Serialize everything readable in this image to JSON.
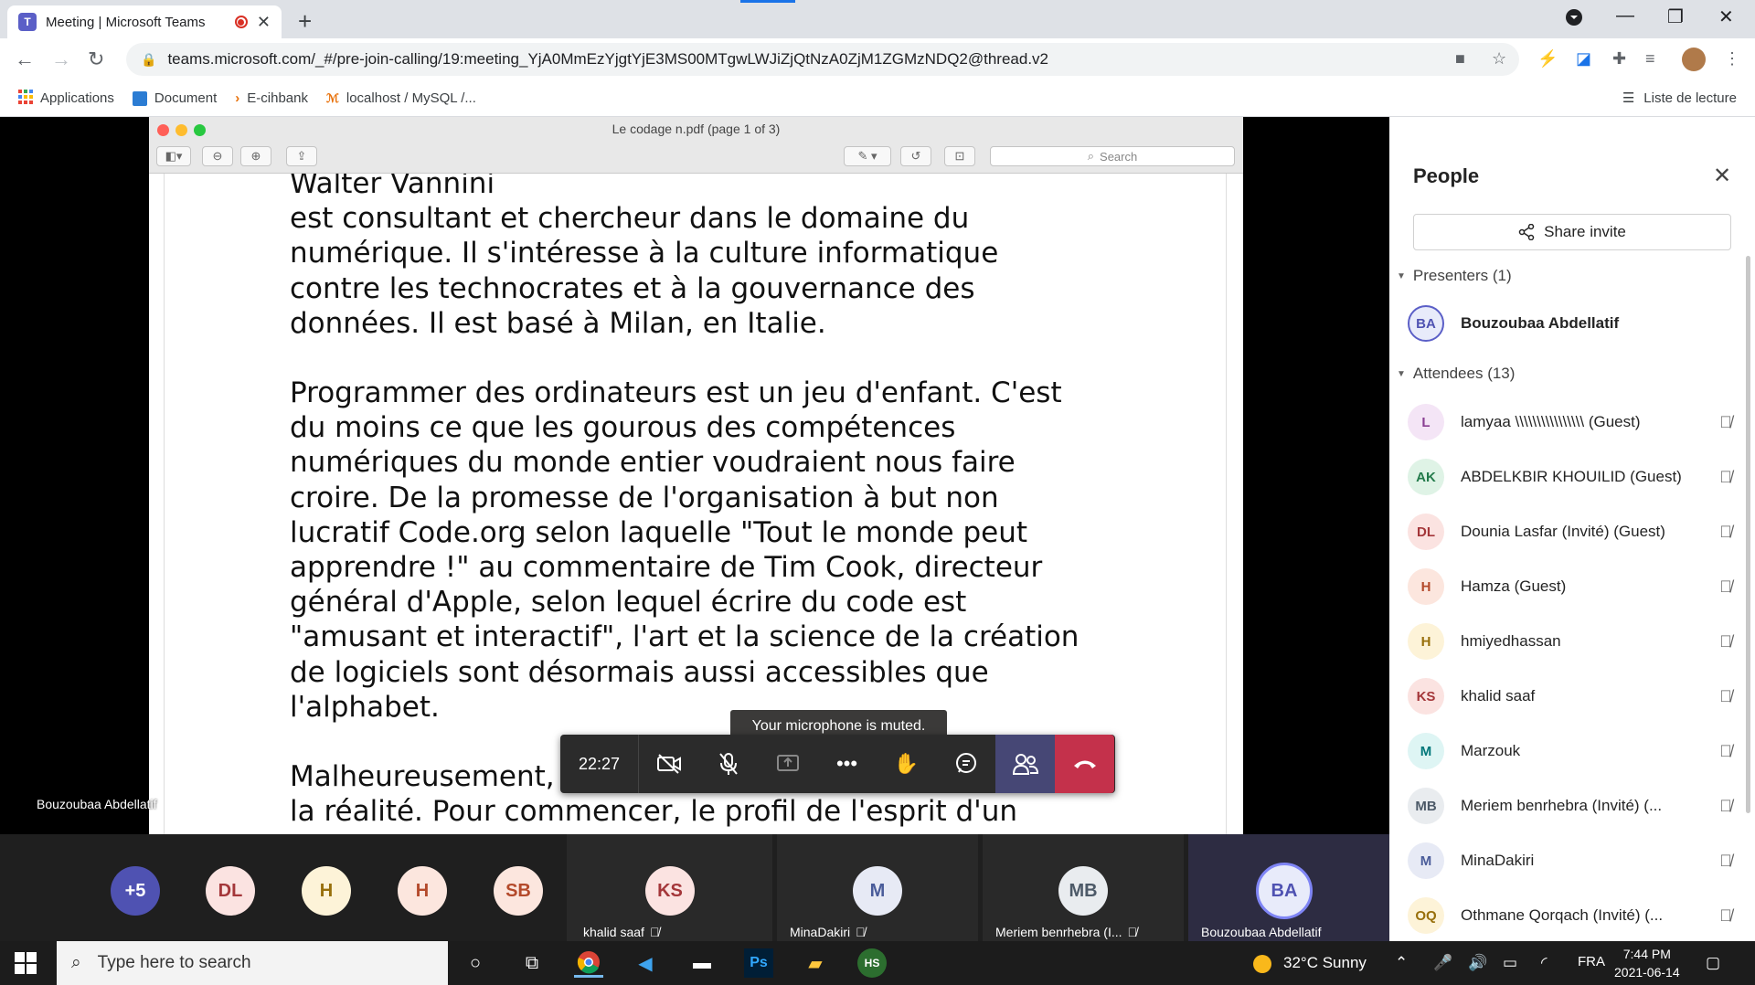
{
  "browser": {
    "tab_title": "Meeting | Microsoft Teams",
    "teams_logo": "T",
    "url": "teams.microsoft.com/_#/pre-join-calling/19:meeting_YjA0MmEzYjgtYjE3MS00MTgwLWJiZjQtNzA0ZjM1ZGMzNDQ2@thread.v2",
    "bookmarks": [
      "Applications",
      "Document",
      "E-cihbank",
      "localhost / MySQL /..."
    ],
    "reading_list": "Liste de lecture"
  },
  "pdf": {
    "title": "Le codage n.pdf (page 1 of 3)",
    "search_placeholder": "Search",
    "paragraphs": [
      "Walter Vannini\nest consultant et chercheur dans le domaine du\nnumérique. Il s'intéresse à la culture informatique\ncontre les technocrates et à la gouvernance des\ndonnées. Il est basé à Milan, en Italie.",
      "Programmer des ordinateurs est un jeu d'enfant. C'est\ndu moins ce que les gourous des compétences\nnumériques du monde entier voudraient nous faire\ncroire. De la promesse de l'organisation à but non\nlucratif Code.org selon laquelle \"Tout le monde peut\napprendre !\" au commentaire de Tim Cook, directeur\ngénéral d'Apple, selon lequel écrire du code est\n\"amusant et interactif\", l'art et la science de la création\nde logiciels sont désormais aussi accessibles que\nl'alphabet.",
      "Malheureusement, ce portrait n'a rien à voir avec\nla réalité. Pour commencer, le profil de l'esprit d'un"
    ]
  },
  "presenter_label": "Bouzoubaa Abdellatif",
  "call": {
    "duration": "22:27",
    "tooltip": "Your microphone is muted."
  },
  "people": {
    "title": "People",
    "share_invite": "Share invite",
    "presenters_header": "Presenters (1)",
    "attendees_header": "Attendees (13)",
    "presenters": [
      {
        "initials": "BA",
        "name": "Bouzoubaa Abdellatif"
      }
    ],
    "attendees": [
      {
        "initials": "L",
        "name": "lamyaa \\\\\\\\\\\\\\\\\\\\\\\\\\\\\\\\ (Guest)"
      },
      {
        "initials": "AK",
        "name": "ABDELKBIR KHOUILID (Guest)"
      },
      {
        "initials": "DL",
        "name": "Dounia Lasfar (Invité) (Guest)"
      },
      {
        "initials": "H",
        "name": "Hamza (Guest)"
      },
      {
        "initials": "H",
        "name": "hmiyedhassan"
      },
      {
        "initials": "KS",
        "name": "khalid saaf"
      },
      {
        "initials": "M",
        "name": "Marzouk"
      },
      {
        "initials": "MB",
        "name": "Meriem benrhebra (Invité) (..."
      },
      {
        "initials": "M",
        "name": "MinaDakiri"
      },
      {
        "initials": "OQ",
        "name": "Othmane Qorqach (Invité) (..."
      }
    ]
  },
  "strip": {
    "overflow": "+5",
    "avatars": [
      "DL",
      "H",
      "H",
      "SB"
    ],
    "tiles": [
      {
        "initials": "KS",
        "name": "khalid saaf"
      },
      {
        "initials": "M",
        "name": "MinaDakiri"
      },
      {
        "initials": "MB",
        "name": "Meriem benrhebra (I..."
      },
      {
        "initials": "BA",
        "name": "Bouzoubaa Abdellatif"
      }
    ]
  },
  "taskbar": {
    "search_placeholder": "Type here to search",
    "hs_label": "HS",
    "weather": "32°C  Sunny",
    "lang": "FRA",
    "time": "7:44 PM",
    "date": "2021-06-14"
  },
  "colors": {
    "teams_purple": "#464775",
    "hangup_red": "#c4314b"
  }
}
